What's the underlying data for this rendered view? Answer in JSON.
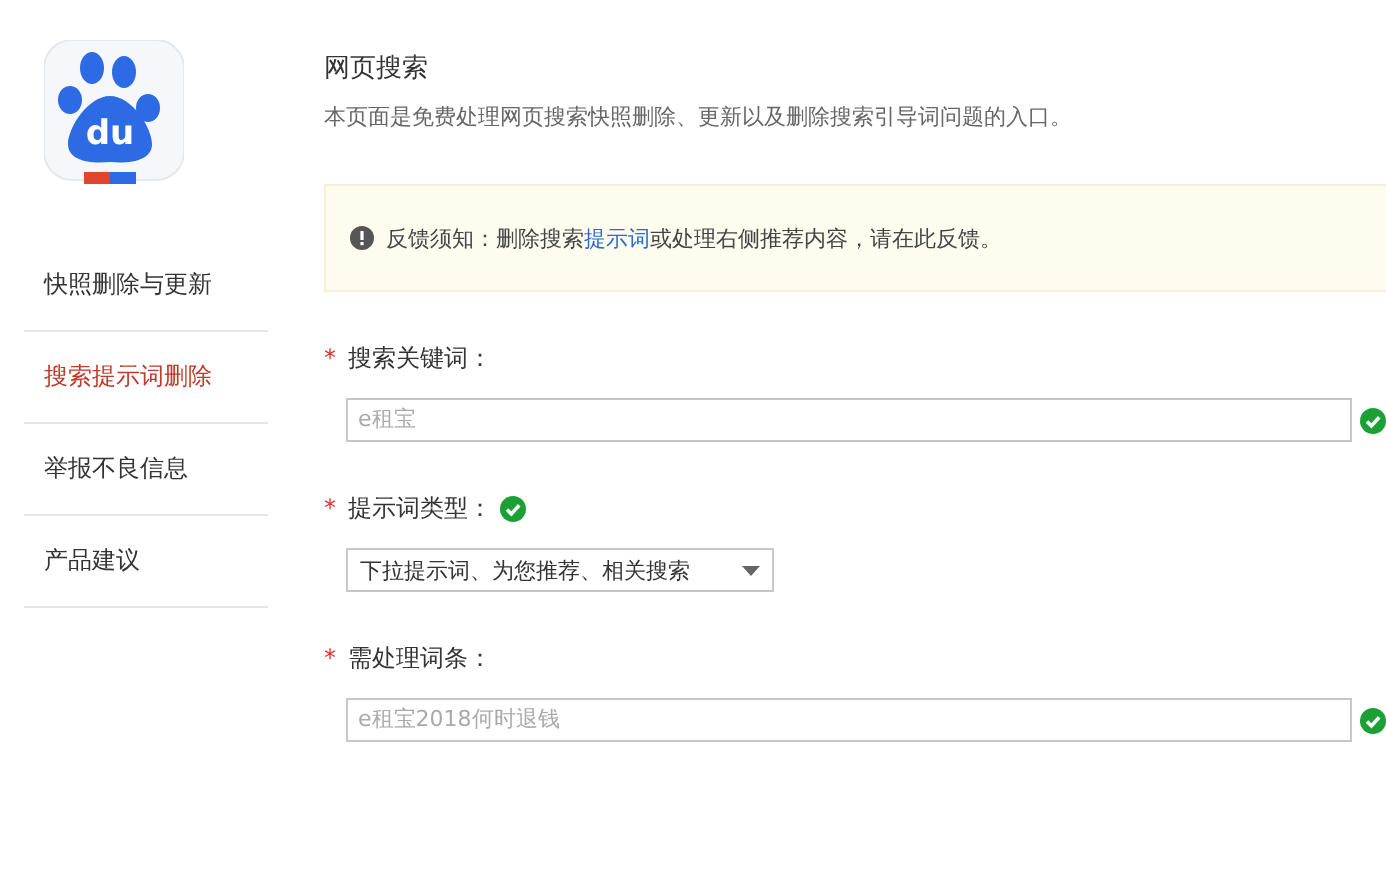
{
  "logo": {
    "text": "du"
  },
  "sidebar": {
    "items": [
      {
        "label": "快照删除与更新",
        "selected": false
      },
      {
        "label": "搜索提示词删除",
        "selected": true
      },
      {
        "label": "举报不良信息",
        "selected": false
      },
      {
        "label": "产品建议",
        "selected": false
      }
    ]
  },
  "header": {
    "title": "网页搜索",
    "description": "本页面是免费处理网页搜索快照删除、更新以及删除搜索引导词问题的入口。"
  },
  "notice": {
    "before": "反馈须知：删除搜索",
    "link": "提示词",
    "after": "或处理右侧推荐内容，请在此反馈。"
  },
  "form": {
    "fields": [
      {
        "kind": "text",
        "label": "搜索关键词：",
        "required_mark": "*",
        "valid": true,
        "value": "e租宝"
      },
      {
        "kind": "select",
        "label": "提示词类型：",
        "required_mark": "*",
        "valid": true,
        "value": "下拉提示词、为您推荐、相关搜索"
      },
      {
        "kind": "text",
        "label": "需处理词条：",
        "required_mark": "*",
        "valid": true,
        "value": "e租宝2018何时退钱"
      }
    ]
  }
}
